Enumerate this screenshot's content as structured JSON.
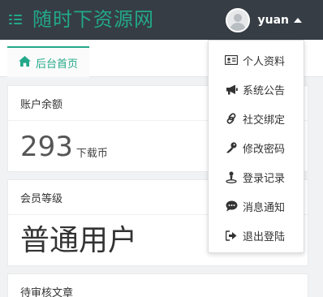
{
  "header": {
    "brand": "随时下资源网",
    "username": "yuan"
  },
  "tabs": [
    {
      "label": "后台首页",
      "icon": "home-icon"
    }
  ],
  "cards": {
    "balance": {
      "title": "账户余额",
      "value": "293",
      "unit": "下载币"
    },
    "level": {
      "title": "会员等级",
      "value": "普通用户"
    },
    "pending": {
      "title": "待审核文章"
    }
  },
  "dropdown": {
    "items": [
      {
        "label": "个人资料",
        "icon": "id-card-icon"
      },
      {
        "label": "系统公告",
        "icon": "megaphone-icon"
      },
      {
        "label": "社交绑定",
        "icon": "link-icon"
      },
      {
        "label": "修改密码",
        "icon": "key-icon"
      },
      {
        "label": "登录记录",
        "icon": "location-icon"
      },
      {
        "label": "消息通知",
        "icon": "chat-icon"
      },
      {
        "label": "退出登陆",
        "icon": "sign-out-icon"
      }
    ]
  },
  "colors": {
    "accent": "#23a889",
    "topbar": "#363d44"
  }
}
